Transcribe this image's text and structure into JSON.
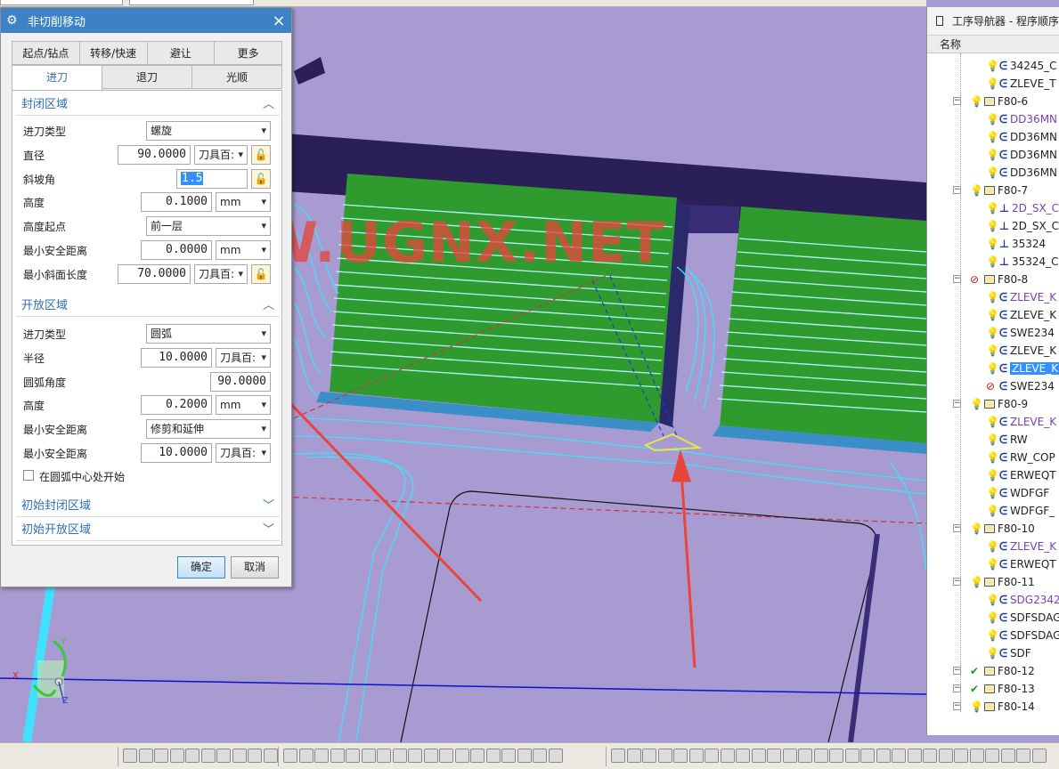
{
  "dialog": {
    "title": "非切削移动",
    "close_icon": "×",
    "tabs_row1": [
      "起点/钻点",
      "转移/快速",
      "避让",
      "更多"
    ],
    "tabs_row2": [
      "进刀",
      "退刀",
      "光顺"
    ],
    "active_tab": "进刀",
    "closed_area": {
      "header": "封闭区域",
      "engage_type_label": "进刀类型",
      "engage_type": "螺旋",
      "diameter_label": "直径",
      "diameter": "90.0000",
      "diameter_unit": "刀具百:",
      "ramp_angle_label": "斜坡角",
      "ramp_angle": "1.5",
      "height_label": "高度",
      "height": "0.1000",
      "height_unit": "mm",
      "height_from_label": "高度起点",
      "height_from": "前一层",
      "min_clearance_label": "最小安全距离",
      "min_clearance": "0.0000",
      "min_clearance_unit": "mm",
      "min_ramp_length_label": "最小斜面长度",
      "min_ramp_length": "70.0000",
      "min_ramp_length_unit": "刀具百:"
    },
    "open_area": {
      "header": "开放区域",
      "engage_type_label": "进刀类型",
      "engage_type": "圆弧",
      "radius_label": "半径",
      "radius": "10.0000",
      "radius_unit": "刀具百:",
      "arc_angle_label": "圆弧角度",
      "arc_angle": "90.0000",
      "height_label": "高度",
      "height": "0.2000",
      "height_unit": "mm",
      "min_clearance_label": "最小安全距离",
      "min_clearance_mode": "修剪和延伸",
      "min_clearance2_label": "最小安全距离",
      "min_clearance2": "10.0000",
      "min_clearance2_unit": "刀具百:",
      "start_at_center_label": "在圆弧中心处开始"
    },
    "initial_closed_label": "初始封闭区域",
    "initial_open_label": "初始开放区域",
    "ok_label": "确定",
    "cancel_label": "取消"
  },
  "watermark": "WWW.UGNX.NET",
  "navigator": {
    "title": "工序导航器 - 程序顺序",
    "column_name": "名称",
    "items": [
      {
        "name": "34245_C",
        "type": "op",
        "status": "bulb",
        "level": 2
      },
      {
        "name": "ZLEVE_T",
        "type": "op",
        "status": "bulb",
        "level": 2
      },
      {
        "name": "F80-6",
        "type": "group",
        "status": "bulb",
        "level": 1
      },
      {
        "name": "DD36MN",
        "type": "op",
        "status": "bulb",
        "level": 2,
        "style": "purple"
      },
      {
        "name": "DD36MN",
        "type": "op",
        "status": "bulb",
        "level": 2
      },
      {
        "name": "DD36MN",
        "type": "op",
        "status": "bulb",
        "level": 2
      },
      {
        "name": "DD36MN",
        "type": "op",
        "status": "bulb",
        "level": 2
      },
      {
        "name": "F80-7",
        "type": "group",
        "status": "bulb",
        "level": 1
      },
      {
        "name": "2D_SX_C",
        "type": "op2d",
        "status": "bulb",
        "level": 2,
        "style": "purple"
      },
      {
        "name": "2D_SX_C",
        "type": "op2d",
        "status": "bulb",
        "level": 2
      },
      {
        "name": "35324",
        "type": "op2d",
        "status": "bulb",
        "level": 2
      },
      {
        "name": "35324_C",
        "type": "op2d",
        "status": "bulb",
        "level": 2
      },
      {
        "name": "F80-8",
        "type": "group",
        "status": "noop",
        "level": 1
      },
      {
        "name": "ZLEVE_K",
        "type": "op",
        "status": "bulb",
        "level": 2,
        "style": "purple"
      },
      {
        "name": "ZLEVE_K",
        "type": "op",
        "status": "bulb",
        "level": 2
      },
      {
        "name": "SWE234",
        "type": "op",
        "status": "bulb",
        "level": 2
      },
      {
        "name": "ZLEVE_K",
        "type": "op",
        "status": "bulb",
        "level": 2
      },
      {
        "name": "ZLEVE_K",
        "type": "op",
        "status": "bulb",
        "level": 2,
        "style": "sel"
      },
      {
        "name": "SWE234",
        "type": "op",
        "status": "noop",
        "level": 2
      },
      {
        "name": "F80-9",
        "type": "group",
        "status": "bulb",
        "level": 1
      },
      {
        "name": "ZLEVE_K",
        "type": "op",
        "status": "bulb",
        "level": 2,
        "style": "purple"
      },
      {
        "name": "RW",
        "type": "op",
        "status": "bulb",
        "level": 2
      },
      {
        "name": "RW_COP",
        "type": "op",
        "status": "bulb",
        "level": 2
      },
      {
        "name": "ERWEQT",
        "type": "op",
        "status": "bulb",
        "level": 2
      },
      {
        "name": "WDFGF",
        "type": "op",
        "status": "bulb",
        "level": 2
      },
      {
        "name": "WDFGF_",
        "type": "op",
        "status": "bulb",
        "level": 2
      },
      {
        "name": "F80-10",
        "type": "group",
        "status": "bulb",
        "level": 1
      },
      {
        "name": "ZLEVE_K",
        "type": "op",
        "status": "bulb",
        "level": 2,
        "style": "purple"
      },
      {
        "name": "ERWEQT",
        "type": "op",
        "status": "bulb",
        "level": 2
      },
      {
        "name": "F80-11",
        "type": "group",
        "status": "bulb",
        "level": 1
      },
      {
        "name": "SDG2342",
        "type": "op",
        "status": "bulb",
        "level": 2,
        "style": "purple"
      },
      {
        "name": "SDFSDAG",
        "type": "op",
        "status": "bulb",
        "level": 2
      },
      {
        "name": "SDFSDAG",
        "type": "op",
        "status": "bulb",
        "level": 2
      },
      {
        "name": "SDF",
        "type": "op",
        "status": "bulb",
        "level": 2
      },
      {
        "name": "F80-12",
        "type": "group",
        "status": "check",
        "level": 1
      },
      {
        "name": "F80-13",
        "type": "group",
        "status": "check",
        "level": 1
      },
      {
        "name": "F80-14",
        "type": "group",
        "status": "bulb",
        "level": 1
      }
    ]
  },
  "triad": {
    "x": "X",
    "y": "Y",
    "z": "Z"
  },
  "colors": {
    "viewport_bg": "#a89bd1",
    "toolpath": "#40e0ff",
    "part": "#2f9b2f",
    "title_bar": "#3d82c7",
    "arrow": "#e8453c"
  }
}
